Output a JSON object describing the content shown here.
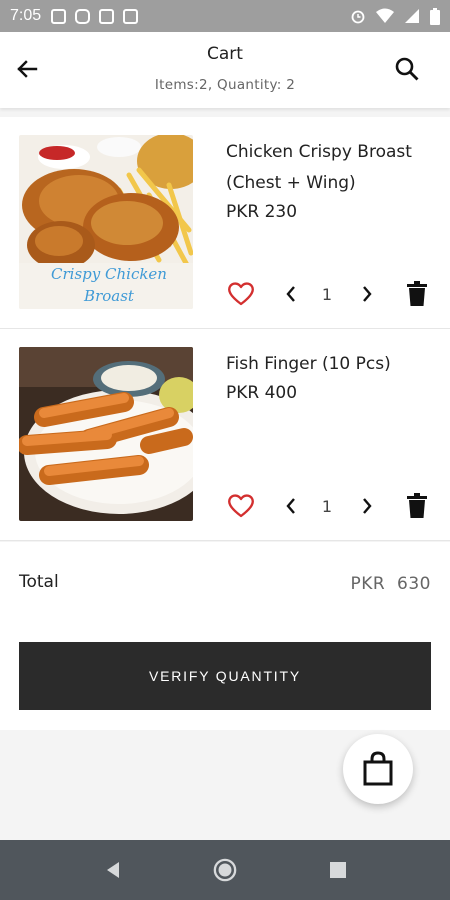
{
  "status_bar": {
    "time": "7:05",
    "left_icons": [
      "image-icon",
      "instagram-icon",
      "gmail-icon",
      "news-icon"
    ],
    "right_icons": [
      "alarm-icon",
      "wifi-icon",
      "signal-icon",
      "battery-icon"
    ]
  },
  "header": {
    "title": "Cart",
    "subtitle": "Items:2, Quantity: 2",
    "back_icon": "arrow-back-icon",
    "search_icon": "search-icon"
  },
  "cart_items": [
    {
      "name": "Chicken Crispy Broast (Chest + Wing)",
      "price": "PKR 230",
      "quantity": "1",
      "image_caption": "Crispy Chicken Broast"
    },
    {
      "name": "Fish Finger (10 Pcs)",
      "price": "PKR 400",
      "quantity": "1"
    }
  ],
  "summary": {
    "total_label": "Total",
    "total_value": "PKR  630",
    "verify_label": "VERIFY QUANTITY"
  },
  "fab_icon": "shopping-bag-icon",
  "nav_icons": [
    "back-triangle-icon",
    "home-circle-icon",
    "recents-square-icon"
  ],
  "colors": {
    "status_bar": "#9e9e9e",
    "heart": "#d32f2f",
    "button": "#2b2b2b",
    "nav_bar": "#50565c"
  }
}
